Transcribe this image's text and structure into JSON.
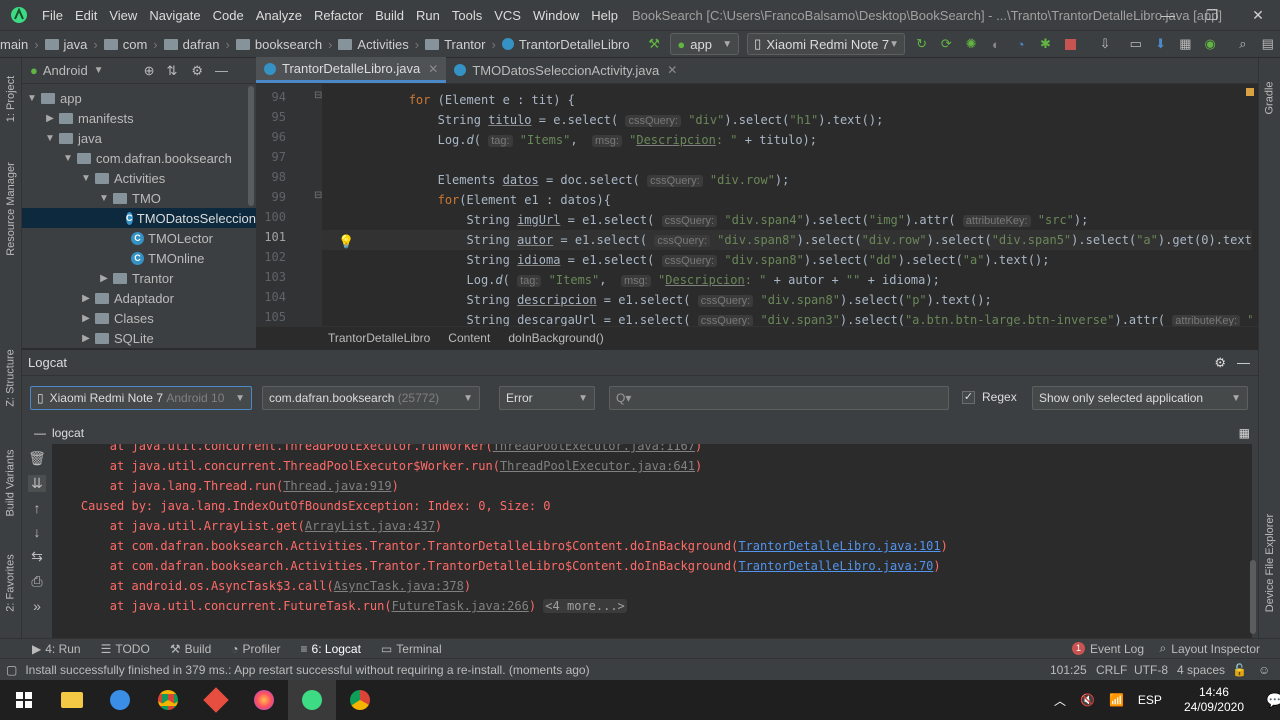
{
  "menubar": {
    "items": [
      "File",
      "Edit",
      "View",
      "Navigate",
      "Code",
      "Analyze",
      "Refactor",
      "Build",
      "Run",
      "Tools",
      "VCS",
      "Window",
      "Help"
    ],
    "title": "BookSearch [C:\\Users\\FrancoBalsamo\\Desktop\\BookSearch] - ...\\Tranto\\TrantorDetalleLibro.java [app]"
  },
  "navbar": {
    "crumbs": [
      "main",
      "java",
      "com",
      "dafran",
      "booksearch",
      "Activities",
      "Trantor",
      "TrantorDetalleLibro"
    ],
    "run_config": "app",
    "device": "Xiaomi Redmi Note 7"
  },
  "sidebar": {
    "vtabs": [
      "1: Project",
      "Resource Manager",
      "Z: Structure",
      "Build Variants",
      "2: Favorites"
    ]
  },
  "rightbar": {
    "vtabs": [
      "Gradle",
      "Device File Explorer"
    ]
  },
  "project": {
    "view": "Android",
    "tree": [
      {
        "label": "app",
        "depth": 0,
        "type": "folder",
        "arrow": "▼"
      },
      {
        "label": "manifests",
        "depth": 1,
        "type": "folder",
        "arrow": "▶"
      },
      {
        "label": "java",
        "depth": 1,
        "type": "folder",
        "arrow": "▼"
      },
      {
        "label": "com.dafran.booksearch",
        "depth": 2,
        "type": "folder",
        "arrow": "▼"
      },
      {
        "label": "Activities",
        "depth": 3,
        "type": "folder",
        "arrow": "▼"
      },
      {
        "label": "TMO",
        "depth": 4,
        "type": "folder",
        "arrow": "▼"
      },
      {
        "label": "TMODatosSeleccion",
        "depth": 5,
        "type": "class",
        "arrow": "",
        "selected": true
      },
      {
        "label": "TMOLector",
        "depth": 5,
        "type": "class",
        "arrow": ""
      },
      {
        "label": "TMOnline",
        "depth": 5,
        "type": "class",
        "arrow": ""
      },
      {
        "label": "Trantor",
        "depth": 4,
        "type": "folder",
        "arrow": "▶"
      },
      {
        "label": "Adaptador",
        "depth": 3,
        "type": "folder",
        "arrow": "▶"
      },
      {
        "label": "Clases",
        "depth": 3,
        "type": "folder",
        "arrow": "▶"
      },
      {
        "label": "SQLite",
        "depth": 3,
        "type": "folder",
        "arrow": "▶"
      }
    ]
  },
  "editor": {
    "tabs": [
      "TrantorDetalleLibro.java",
      "TMODatosSeleccionActivity.java"
    ],
    "lines": [
      {
        "n": "94",
        "html": "            <span class=\"kw\">for</span> (Element e : tit) {"
      },
      {
        "n": "95",
        "html": "                String <span class=\"var\">titulo</span> = e.select( <span class=\"hint\">cssQuery:</span> <span class=\"str\">\"div\"</span>).select(<span class=\"str\">\"h1\"</span>).text();"
      },
      {
        "n": "96",
        "html": "                Log.<i>d</i>( <span class=\"hint\">tag:</span> <span class=\"str\">\"Items\"</span>,  <span class=\"hint\">msg:</span> <span class=\"str\">\"<span class=\"var\">Descripcion</span>: \"</span> + titulo);"
      },
      {
        "n": "97",
        "html": ""
      },
      {
        "n": "98",
        "html": "                Elements <span class=\"var\">datos</span> = doc.select( <span class=\"hint\">cssQuery:</span> <span class=\"str\">\"div.row\"</span>);"
      },
      {
        "n": "99",
        "html": "                <span class=\"kw\">for</span>(Element e1 : datos){"
      },
      {
        "n": "100",
        "html": "                    String <span class=\"var\">imgUrl</span> = e1.select( <span class=\"hint\">cssQuery:</span> <span class=\"str\">\"div.span4\"</span>).select(<span class=\"str\">\"img\"</span>).attr( <span class=\"hint\">attributeKey:</span> <span class=\"str\">\"src\"</span>);"
      },
      {
        "n": "101",
        "html": "                    String <span class=\"var\">autor</span> = e1.select( <span class=\"hint\">cssQuery:</span> <span class=\"str\">\"div.span8\"</span>).select(<span class=\"str\">\"div.row\"</span>).select(<span class=\"str\">\"div.span5\"</span>).select(<span class=\"str\">\"a\"</span>).get(0).text(",
        "current": true
      },
      {
        "n": "102",
        "html": "                    String <span class=\"var\">idioma</span> = e1.select( <span class=\"hint\">cssQuery:</span> <span class=\"str\">\"div.span8\"</span>).select(<span class=\"str\">\"dd\"</span>).select(<span class=\"str\">\"a\"</span>).text();"
      },
      {
        "n": "103",
        "html": "                    Log.<i>d</i>( <span class=\"hint\">tag:</span> <span class=\"str\">\"Items\"</span>,  <span class=\"hint\">msg:</span> <span class=\"str\">\"<span class=\"var\">Descripcion</span>: \"</span> + autor + <span class=\"str\">\"\"</span> + idioma);"
      },
      {
        "n": "104",
        "html": "                    String <span class=\"var\">descripcion</span> = e1.select( <span class=\"hint\">cssQuery:</span> <span class=\"str\">\"div.span8\"</span>).select(<span class=\"str\">\"p\"</span>).text();"
      },
      {
        "n": "105",
        "html": "                    String descargaUrl = e1.select( <span class=\"hint\">cssQuery:</span> <span class=\"str\">\"div.span3\"</span>).select(<span class=\"str\">\"a.btn.btn-large.btn-inverse\"</span>).attr( <span class=\"hint\">attributeKey:</span> <span class=\"str\">\"h</span>"
      }
    ],
    "breadcrumb": [
      "TrantorDetalleLibro",
      "Content",
      "doInBackground()"
    ]
  },
  "logcat": {
    "title": "Logcat",
    "device_name": "Xiaomi Redmi Note 7",
    "device_suffix": "Android 10",
    "process_name": "com.dafran.booksearch",
    "process_pid": "(25772)",
    "level": "Error",
    "search_placeholder": "Q▾",
    "regex_label": "Regex",
    "filter": "Show only selected application",
    "subtab": "logcat",
    "lines": [
      {
        "indent": "        ",
        "text": "at java.util.concurrent.ThreadPoolExecutor.runWorker(",
        "link": "ThreadPoolExecutor.java:1167",
        "end": ")",
        "linkclass": "gray"
      },
      {
        "indent": "        ",
        "text": "at java.util.concurrent.ThreadPoolExecutor$Worker.run(",
        "link": "ThreadPoolExecutor.java:641",
        "end": ")",
        "linkclass": "gray"
      },
      {
        "indent": "        ",
        "text": "at java.lang.Thread.run(",
        "link": "Thread.java:919",
        "end": ")",
        "linkclass": "gray"
      },
      {
        "indent": "    ",
        "text": "Caused by: java.lang.IndexOutOfBoundsException: Index: 0, Size: 0",
        "link": "",
        "end": "",
        "linkclass": ""
      },
      {
        "indent": "        ",
        "text": "at java.util.ArrayList.get(",
        "link": "ArrayList.java:437",
        "end": ")",
        "linkclass": "gray"
      },
      {
        "indent": "        ",
        "text": "at com.dafran.booksearch.Activities.Trantor.TrantorDetalleLibro$Content.doInBackground(",
        "link": "TrantorDetalleLibro.java:101",
        "end": ")",
        "linkclass": "link"
      },
      {
        "indent": "        ",
        "text": "at com.dafran.booksearch.Activities.Trantor.TrantorDetalleLibro$Content.doInBackground(",
        "link": "TrantorDetalleLibro.java:70",
        "end": ")",
        "linkclass": "link"
      },
      {
        "indent": "        ",
        "text": "at android.os.AsyncTask$3.call(",
        "link": "AsyncTask.java:378",
        "end": ")",
        "linkclass": "gray"
      },
      {
        "indent": "        ",
        "text": "at java.util.concurrent.FutureTask.run(",
        "link": "FutureTask.java:266",
        "end": ") ",
        "linkclass": "gray",
        "more": "<4 more...>"
      }
    ]
  },
  "toolwindows": {
    "left": [
      {
        "icon": "▶",
        "label": "4: Run"
      },
      {
        "icon": "☰",
        "label": "TODO"
      },
      {
        "icon": "⚒",
        "label": "Build"
      },
      {
        "icon": "◔",
        "label": "Profiler"
      },
      {
        "icon": "≡",
        "label": "6: Logcat"
      },
      {
        "icon": "▭",
        "label": "Terminal"
      }
    ],
    "event_log_count": "1",
    "event_log": "Event Log",
    "layout_inspector": "Layout Inspector"
  },
  "status": {
    "message": "Install successfully finished in 379 ms.: App restart successful without requiring a re-install. (moments ago)",
    "position": "101:25",
    "line_sep": "CRLF",
    "encoding": "UTF-8",
    "indent": "4 spaces"
  },
  "taskbar": {
    "lang": "ESP",
    "time": "14:46",
    "date": "24/09/2020"
  },
  "colors": {
    "accent": "#4a88c7",
    "error": "#ff6b68",
    "link": "#5394ec",
    "selection": "#0d293e"
  }
}
